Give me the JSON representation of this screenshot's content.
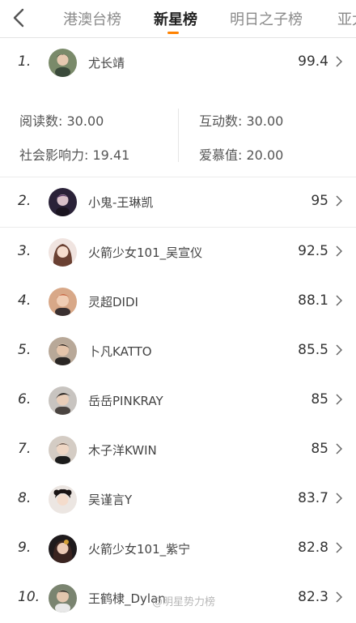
{
  "tabs": [
    "港澳台榜",
    "新星榜",
    "明日之子榜",
    "亚太"
  ],
  "active_tab_index": 1,
  "colors": {
    "accent": "#ff8200",
    "text": "#333333",
    "muted": "#8a8a8a",
    "divider": "#ececec"
  },
  "icons": {
    "back": "chevron-left-icon",
    "row_arrow": "chevron-right-icon"
  },
  "stats": {
    "read_label": "阅读数:",
    "read_value": "30.00",
    "interact_label": "互动数:",
    "interact_value": "30.00",
    "social_label": "社会影响力:",
    "social_value": "19.41",
    "love_label": "爱慕值:",
    "love_value": "20.00"
  },
  "rows": [
    {
      "rank": "1.",
      "name": "尤长靖",
      "score": "99.4"
    },
    {
      "rank": "2.",
      "name": "小鬼-王琳凯",
      "score": "95"
    },
    {
      "rank": "3.",
      "name": "火箭少女101_吴宣仪",
      "score": "92.5"
    },
    {
      "rank": "4.",
      "name": "灵超DIDI",
      "score": "88.1"
    },
    {
      "rank": "5.",
      "name": "卜凡KATTO",
      "score": "85.5"
    },
    {
      "rank": "6.",
      "name": "岳岳PINKRAY",
      "score": "85"
    },
    {
      "rank": "7.",
      "name": "木子洋KWIN",
      "score": "85"
    },
    {
      "rank": "8.",
      "name": "吴谨言Y",
      "score": "83.7"
    },
    {
      "rank": "9.",
      "name": "火箭少女101_紫宁",
      "score": "82.8"
    },
    {
      "rank": "10.",
      "name": "王鹤棣_Dylan",
      "score": "82.3"
    }
  ],
  "watermark": "@明星势力榜"
}
